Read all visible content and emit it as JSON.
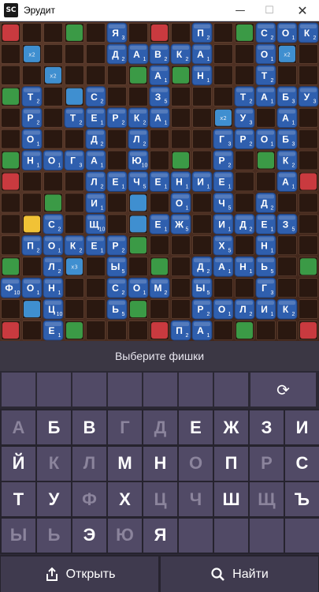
{
  "window": {
    "title": "Эрудит",
    "logo": "SC",
    "min_icon": "—",
    "max_icon": "☐",
    "close_icon": "✕"
  },
  "board": {
    "size": 15,
    "colors": {
      "background": "#4a2e22",
      "tile": "#2f5fae",
      "tile_text": "#ffffff",
      "bonus_red": "#c93a3f",
      "bonus_green": "#3b9a46",
      "bonus_blue": "#3f8fd0",
      "bonus_yellow": "#f1c236"
    },
    "bonus_cells": [
      {
        "r": 0,
        "c": 0,
        "t": "red"
      },
      {
        "r": 0,
        "c": 3,
        "t": "green"
      },
      {
        "r": 0,
        "c": 7,
        "t": "red"
      },
      {
        "r": 0,
        "c": 11,
        "t": "green"
      },
      {
        "r": 0,
        "c": 14,
        "t": "red"
      },
      {
        "r": 1,
        "c": 1,
        "t": "blue",
        "label": "x2"
      },
      {
        "r": 1,
        "c": 13,
        "t": "blue",
        "label": "x2"
      },
      {
        "r": 2,
        "c": 2,
        "t": "blue",
        "label": "x2"
      },
      {
        "r": 2,
        "c": 6,
        "t": "green"
      },
      {
        "r": 2,
        "c": 8,
        "t": "green"
      },
      {
        "r": 3,
        "c": 0,
        "t": "green"
      },
      {
        "r": 3,
        "c": 3,
        "t": "blue"
      },
      {
        "r": 3,
        "c": 14,
        "t": "green"
      },
      {
        "r": 4,
        "c": 6,
        "t": "red"
      },
      {
        "r": 4,
        "c": 10,
        "t": "blue",
        "label": "x2"
      },
      {
        "r": 6,
        "c": 0,
        "t": "green"
      },
      {
        "r": 6,
        "c": 8,
        "t": "green"
      },
      {
        "r": 6,
        "c": 12,
        "t": "green"
      },
      {
        "r": 7,
        "c": 0,
        "t": "red"
      },
      {
        "r": 7,
        "c": 7,
        "t": "blue"
      },
      {
        "r": 7,
        "c": 14,
        "t": "red"
      },
      {
        "r": 8,
        "c": 2,
        "t": "green"
      },
      {
        "r": 8,
        "c": 6,
        "t": "blue"
      },
      {
        "r": 8,
        "c": 12,
        "t": "green"
      },
      {
        "r": 9,
        "c": 1,
        "t": "yellow"
      },
      {
        "r": 9,
        "c": 6,
        "t": "blue"
      },
      {
        "r": 10,
        "c": 6,
        "t": "green"
      },
      {
        "r": 11,
        "c": 0,
        "t": "green"
      },
      {
        "r": 11,
        "c": 3,
        "t": "blue",
        "label": "x3"
      },
      {
        "r": 11,
        "c": 7,
        "t": "green"
      },
      {
        "r": 11,
        "c": 14,
        "t": "green"
      },
      {
        "r": 12,
        "c": 12,
        "t": "blue"
      },
      {
        "r": 13,
        "c": 1,
        "t": "blue"
      },
      {
        "r": 13,
        "c": 6,
        "t": "green"
      },
      {
        "r": 14,
        "c": 0,
        "t": "red"
      },
      {
        "r": 14,
        "c": 3,
        "t": "green"
      },
      {
        "r": 14,
        "c": 7,
        "t": "red"
      },
      {
        "r": 14,
        "c": 11,
        "t": "green"
      },
      {
        "r": 14,
        "c": 14,
        "t": "red"
      }
    ],
    "tiles": [
      {
        "r": 0,
        "c": 5,
        "l": "Я",
        "p": "3"
      },
      {
        "r": 0,
        "c": 9,
        "l": "П",
        "p": "2"
      },
      {
        "r": 0,
        "c": 12,
        "l": "С",
        "p": "2"
      },
      {
        "r": 0,
        "c": 13,
        "l": "О",
        "p": "1"
      },
      {
        "r": 0,
        "c": 14,
        "l": "К",
        "p": "2"
      },
      {
        "r": 1,
        "c": 5,
        "l": "Д",
        "p": "2"
      },
      {
        "r": 1,
        "c": 6,
        "l": "А",
        "p": "1"
      },
      {
        "r": 1,
        "c": 7,
        "l": "В",
        "p": "2"
      },
      {
        "r": 1,
        "c": 8,
        "l": "К",
        "p": "2"
      },
      {
        "r": 1,
        "c": 9,
        "l": "А",
        "p": "1"
      },
      {
        "r": 1,
        "c": 12,
        "l": "О",
        "p": "1"
      },
      {
        "r": 2,
        "c": 7,
        "l": "А",
        "p": "1"
      },
      {
        "r": 2,
        "c": 9,
        "l": "Н",
        "p": "1"
      },
      {
        "r": 2,
        "c": 12,
        "l": "Т",
        "p": "2"
      },
      {
        "r": 3,
        "c": 1,
        "l": "Т",
        "p": "2"
      },
      {
        "r": 3,
        "c": 4,
        "l": "С",
        "p": "2"
      },
      {
        "r": 3,
        "c": 7,
        "l": "З",
        "p": "5"
      },
      {
        "r": 3,
        "c": 11,
        "l": "Т",
        "p": "2"
      },
      {
        "r": 3,
        "c": 12,
        "l": "А",
        "p": "1"
      },
      {
        "r": 3,
        "c": 13,
        "l": "Б",
        "p": "3"
      },
      {
        "r": 3,
        "c": 14,
        "l": "У",
        "p": "3"
      },
      {
        "r": 4,
        "c": 1,
        "l": "Р",
        "p": "2"
      },
      {
        "r": 4,
        "c": 3,
        "l": "Т",
        "p": "2"
      },
      {
        "r": 4,
        "c": 4,
        "l": "Е",
        "p": "1"
      },
      {
        "r": 4,
        "c": 5,
        "l": "Р",
        "p": "2"
      },
      {
        "r": 4,
        "c": 6,
        "l": "К",
        "p": "2"
      },
      {
        "r": 4,
        "c": 7,
        "l": "А",
        "p": "1"
      },
      {
        "r": 4,
        "c": 11,
        "l": "У",
        "p": "3"
      },
      {
        "r": 4,
        "c": 13,
        "l": "А",
        "p": "1"
      },
      {
        "r": 5,
        "c": 1,
        "l": "О",
        "p": "1"
      },
      {
        "r": 5,
        "c": 4,
        "l": "Д",
        "p": "2"
      },
      {
        "r": 5,
        "c": 6,
        "l": "Л",
        "p": "2"
      },
      {
        "r": 5,
        "c": 10,
        "l": "Г",
        "p": "3"
      },
      {
        "r": 5,
        "c": 11,
        "l": "Р",
        "p": "2"
      },
      {
        "r": 5,
        "c": 12,
        "l": "О",
        "p": "1"
      },
      {
        "r": 5,
        "c": 13,
        "l": "Б",
        "p": "3"
      },
      {
        "r": 6,
        "c": 1,
        "l": "Н",
        "p": "1"
      },
      {
        "r": 6,
        "c": 2,
        "l": "О",
        "p": "1"
      },
      {
        "r": 6,
        "c": 3,
        "l": "Г",
        "p": "3"
      },
      {
        "r": 6,
        "c": 4,
        "l": "А",
        "p": "1"
      },
      {
        "r": 6,
        "c": 6,
        "l": "Ю",
        "p": "10"
      },
      {
        "r": 6,
        "c": 10,
        "l": "Р",
        "p": "2"
      },
      {
        "r": 6,
        "c": 13,
        "l": "К",
        "p": "2"
      },
      {
        "r": 7,
        "c": 4,
        "l": "Л",
        "p": "2"
      },
      {
        "r": 7,
        "c": 5,
        "l": "Е",
        "p": "1"
      },
      {
        "r": 7,
        "c": 6,
        "l": "Ч",
        "p": "5"
      },
      {
        "r": 7,
        "c": 7,
        "l": "Е",
        "p": "1"
      },
      {
        "r": 7,
        "c": 8,
        "l": "Н",
        "p": "1"
      },
      {
        "r": 7,
        "c": 9,
        "l": "И",
        "p": "1"
      },
      {
        "r": 7,
        "c": 10,
        "l": "Е",
        "p": "1"
      },
      {
        "r": 7,
        "c": 13,
        "l": "А",
        "p": "1"
      },
      {
        "r": 8,
        "c": 4,
        "l": "И",
        "p": "1"
      },
      {
        "r": 8,
        "c": 8,
        "l": "О",
        "p": "1"
      },
      {
        "r": 8,
        "c": 10,
        "l": "Ч",
        "p": "5"
      },
      {
        "r": 8,
        "c": 12,
        "l": "Д",
        "p": "2"
      },
      {
        "r": 9,
        "c": 2,
        "l": "С",
        "p": "2"
      },
      {
        "r": 9,
        "c": 4,
        "l": "Щ",
        "p": "10"
      },
      {
        "r": 9,
        "c": 7,
        "l": "Е",
        "p": "1"
      },
      {
        "r": 9,
        "c": 8,
        "l": "Ж",
        "p": "5"
      },
      {
        "r": 9,
        "c": 10,
        "l": "И",
        "p": "1"
      },
      {
        "r": 9,
        "c": 11,
        "l": "Д",
        "p": "2"
      },
      {
        "r": 9,
        "c": 12,
        "l": "Е",
        "p": "1"
      },
      {
        "r": 9,
        "c": 13,
        "l": "З",
        "p": "5"
      },
      {
        "r": 10,
        "c": 1,
        "l": "П",
        "p": "2"
      },
      {
        "r": 10,
        "c": 2,
        "l": "О",
        "p": "1"
      },
      {
        "r": 10,
        "c": 3,
        "l": "К",
        "p": "2"
      },
      {
        "r": 10,
        "c": 4,
        "l": "Е",
        "p": "1"
      },
      {
        "r": 10,
        "c": 5,
        "l": "Р",
        "p": "2"
      },
      {
        "r": 10,
        "c": 10,
        "l": "Х",
        "p": "5"
      },
      {
        "r": 10,
        "c": 12,
        "l": "Н",
        "p": "1"
      },
      {
        "r": 11,
        "c": 2,
        "l": "Л",
        "p": "2"
      },
      {
        "r": 11,
        "c": 5,
        "l": "Ы",
        "p": "5"
      },
      {
        "r": 11,
        "c": 9,
        "l": "Д",
        "p": "2"
      },
      {
        "r": 11,
        "c": 10,
        "l": "А",
        "p": "1"
      },
      {
        "r": 11,
        "c": 11,
        "l": "Н",
        "p": "1"
      },
      {
        "r": 11,
        "c": 12,
        "l": "Ь",
        "p": "5"
      },
      {
        "r": 12,
        "c": 0,
        "l": "Ф",
        "p": "10"
      },
      {
        "r": 12,
        "c": 1,
        "l": "О",
        "p": "1"
      },
      {
        "r": 12,
        "c": 2,
        "l": "Н",
        "p": "1"
      },
      {
        "r": 12,
        "c": 5,
        "l": "С",
        "p": "2"
      },
      {
        "r": 12,
        "c": 6,
        "l": "О",
        "p": "1"
      },
      {
        "r": 12,
        "c": 7,
        "l": "М",
        "p": "2"
      },
      {
        "r": 12,
        "c": 9,
        "l": "Ы",
        "p": "5"
      },
      {
        "r": 12,
        "c": 12,
        "l": "Г",
        "p": "3"
      },
      {
        "r": 13,
        "c": 2,
        "l": "Ц",
        "p": "10"
      },
      {
        "r": 13,
        "c": 5,
        "l": "Ь",
        "p": "5"
      },
      {
        "r": 13,
        "c": 9,
        "l": "Р",
        "p": "2"
      },
      {
        "r": 13,
        "c": 10,
        "l": "О",
        "p": "1"
      },
      {
        "r": 13,
        "c": 11,
        "l": "Л",
        "p": "2"
      },
      {
        "r": 13,
        "c": 12,
        "l": "И",
        "p": "1"
      },
      {
        "r": 13,
        "c": 13,
        "l": "К",
        "p": "2"
      },
      {
        "r": 14,
        "c": 2,
        "l": "Е",
        "p": "1"
      },
      {
        "r": 14,
        "c": 8,
        "l": "П",
        "p": "2"
      },
      {
        "r": 14,
        "c": 9,
        "l": "А",
        "p": "1"
      }
    ]
  },
  "status": {
    "text": "Выберите фишки"
  },
  "rack": {
    "slots": 7,
    "reset_icon": "⟳"
  },
  "keyboard": {
    "rows": [
      [
        {
          "k": "А",
          "d": true
        },
        {
          "k": "Б",
          "d": false
        },
        {
          "k": "В",
          "d": false
        },
        {
          "k": "Г",
          "d": true
        },
        {
          "k": "Д",
          "d": true
        },
        {
          "k": "Е",
          "d": false
        },
        {
          "k": "Ж",
          "d": false
        },
        {
          "k": "З",
          "d": false
        },
        {
          "k": "И",
          "d": false
        }
      ],
      [
        {
          "k": "Й",
          "d": false
        },
        {
          "k": "К",
          "d": true
        },
        {
          "k": "Л",
          "d": true
        },
        {
          "k": "М",
          "d": false
        },
        {
          "k": "Н",
          "d": false
        },
        {
          "k": "О",
          "d": true
        },
        {
          "k": "П",
          "d": false
        },
        {
          "k": "Р",
          "d": true
        },
        {
          "k": "С",
          "d": false
        }
      ],
      [
        {
          "k": "Т",
          "d": false
        },
        {
          "k": "У",
          "d": false
        },
        {
          "k": "Ф",
          "d": true
        },
        {
          "k": "Х",
          "d": false
        },
        {
          "k": "Ц",
          "d": true
        },
        {
          "k": "Ч",
          "d": true
        },
        {
          "k": "Ш",
          "d": false
        },
        {
          "k": "Щ",
          "d": true
        },
        {
          "k": "Ъ",
          "d": false
        }
      ],
      [
        {
          "k": "Ы",
          "d": true
        },
        {
          "k": "Ь",
          "d": true
        },
        {
          "k": "Э",
          "d": false
        },
        {
          "k": "Ю",
          "d": true
        },
        {
          "k": "Я",
          "d": false
        },
        {
          "k": "",
          "d": false
        },
        {
          "k": "",
          "d": false
        },
        {
          "k": "",
          "d": false
        },
        {
          "k": "",
          "d": false
        }
      ]
    ]
  },
  "actions": {
    "open_label": "Открыть",
    "open_icon": "share-icon",
    "find_label": "Найти",
    "find_icon": "search-icon"
  }
}
